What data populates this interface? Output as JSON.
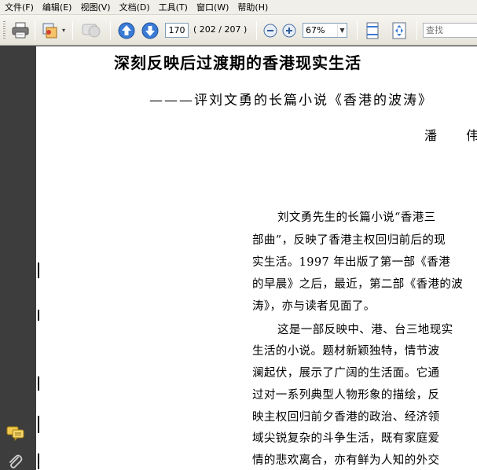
{
  "menu": {
    "items": [
      "文件(F)",
      "编辑(E)",
      "视图(V)",
      "文档(D)",
      "工具(T)",
      "窗口(W)",
      "帮助(H)"
    ]
  },
  "toolbar": {
    "current_page": "170",
    "page_count": "( 202 / 207 )",
    "zoom": "67%",
    "search_placeholder": "查找",
    "icons": [
      "print-icon",
      "layers-icon",
      "comment-icon",
      "prev-page-icon",
      "next-page-icon",
      "zoom-out-icon",
      "zoom-in-icon",
      "fit-width-icon",
      "fit-page-icon"
    ]
  },
  "document": {
    "title": "深刻反映后过渡期的香港现实生活",
    "subtitle": "———评刘文勇的长篇小说《香港的波涛》",
    "author": "潘 伟",
    "body_lines": [
      "刘文勇先生的长篇小说“香港三",
      "部曲”，反映了香港主权回归前后的现",
      "实生活。1997 年出版了第一部《香港",
      "的早晨》之后，最近，第二部《香港的波",
      "涛》，亦与读者见面了。",
      "这是一部反映中、港、台三地现实",
      "生活的小说。题材新颖独特，情节波",
      "澜起伏，展示了广阔的生活面。它通",
      "过对一系列典型人物形象的描绘，反",
      "映主权回归前夕香港的政治、经济领",
      "域尖锐复杂的斗争生活，既有家庭爱",
      "情的悲欢离合，亦有鲜为人知的外交"
    ]
  },
  "colors": {
    "accent_blue": "#2f6fc4",
    "panel_dark": "#3d3d3d",
    "toolbar_bg": "#ecebe4"
  }
}
